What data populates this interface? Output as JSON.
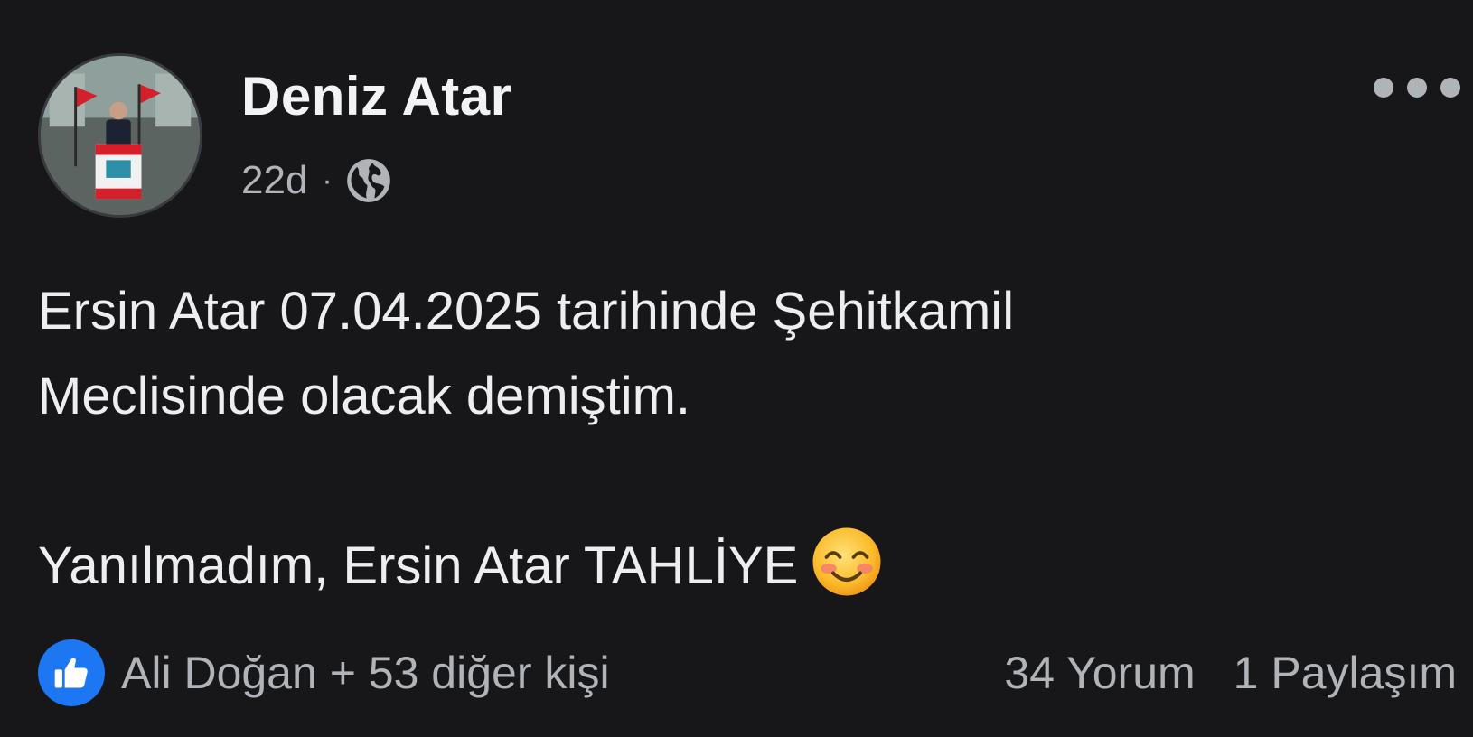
{
  "post": {
    "author": {
      "name": "Deniz Atar"
    },
    "meta": {
      "time": "22d",
      "separator": "·",
      "audience_icon": "globe-icon"
    },
    "more_icon": "more-options-icon",
    "text": {
      "line1": "Ersin Atar 07.04.2025 tarihinde Şehitkamil",
      "line2": "Meclisinde olacak demiştim.",
      "line3": "Yanılmadım, Ersin Atar TAHLİYE",
      "emoji": "smiling-face-icon"
    },
    "footer": {
      "reaction_icon": "like-icon",
      "reactions": "Ali Doğan + 53 diğer kişi",
      "comments": "34 Yorum",
      "shares": "1 Paylaşım"
    },
    "colors": {
      "background": "#17171a",
      "text": "#eceef1",
      "secondary_text": "#b0b3b8",
      "like_blue": "#1d77f2"
    }
  }
}
